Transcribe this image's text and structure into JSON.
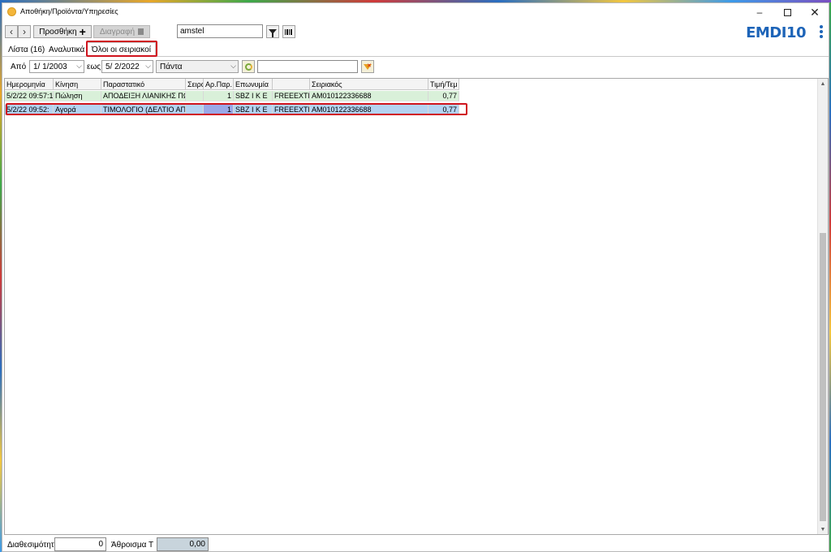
{
  "window": {
    "title": "Αποθήκη/Προϊόντα/Υπηρεσίες"
  },
  "toolbar": {
    "add_label": "Προσθήκη",
    "delete_label": "Διαγραφή",
    "search_value": "amstel",
    "logo_text": "EMDI10"
  },
  "tabs": [
    {
      "label": "Λίστα (16)"
    },
    {
      "label": "Αναλυτικά"
    },
    {
      "label": "Όλοι οι σειριακοί",
      "active": true
    }
  ],
  "filters": {
    "from_label": "Από",
    "from_value": "1/ 1/2003",
    "to_label": "εως",
    "to_value": "5/ 2/2022",
    "period_value": "Πάντα",
    "search_value": ""
  },
  "grid": {
    "columns": [
      "Ημερομηνία",
      "Κίνηση",
      "Παραστατικό",
      "Σειρά",
      "Αρ.Παρ.",
      "Επωνυμία",
      "",
      "Σειριακός",
      "Τιμή/Τεμ"
    ],
    "rows": [
      {
        "kind": "sale",
        "date": "5/2/22 09:57:1",
        "movement": "Πώληση",
        "document": "ΑΠΟΔΕΙΞΗ ΛΙΑΝΙΚΗΣ ΠΩ",
        "series": "",
        "doc_no": "1",
        "name": "SBZ I K E",
        "extra": "FREEEXTRA",
        "serial": "AM010122336688",
        "price": "0,77"
      },
      {
        "kind": "buy",
        "date": "5/2/22 09:52:",
        "movement": "Αγορά",
        "document": "ΤΙΜΟΛΟΓΙΟ (ΔΕΛΤΙΟ ΑΠ",
        "series": "",
        "doc_no": "1",
        "name": "SBZ I K E",
        "extra": "FREEEXTRA",
        "serial": "AM010122336688",
        "price": "0,77"
      }
    ]
  },
  "footer": {
    "available_label": "Διαθεσιμότητα",
    "available_value": "0",
    "sum_label": "Άθροισμα Τιμής",
    "sum_value": "0,00"
  },
  "colors": {
    "highlight": "#d0141e",
    "logo": "#1d64b8",
    "sale_row": "#d9f0d9",
    "buy_row": "#b4d3f2"
  }
}
